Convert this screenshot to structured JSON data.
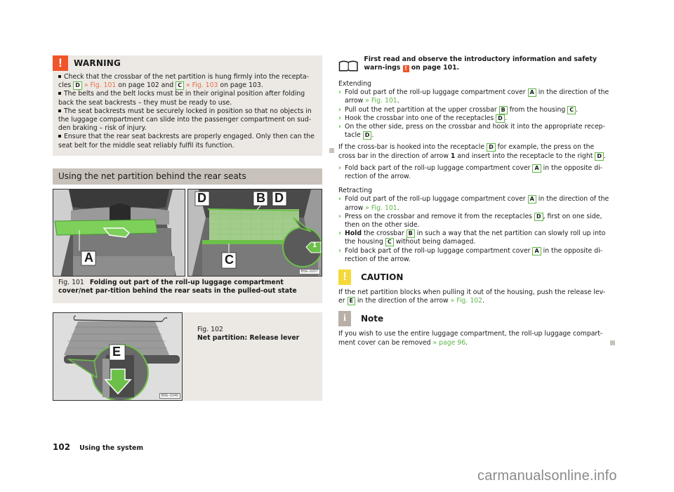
{
  "warning": {
    "icon": "exclamation-icon",
    "title": "WARNING",
    "items": [
      {
        "pre": "Check that the crossbar of the net partition is hung firmly into the recepta-cles ",
        "label1": "D",
        "link1": "» Fig. 101",
        "mid": " on page 102 and ",
        "label2": "C",
        "link2": "» Fig. 103",
        "post": " on page 103."
      },
      {
        "text": "The belts and the belt locks must be in their original position after folding back the seat backrests – they must be ready to use."
      },
      {
        "text": "The seat backrests must be securely locked in position so that no objects in the luggage compartment can slide into the passenger compartment on sud-den braking – risk of injury."
      },
      {
        "text": "Ensure that the rear seat backrests are properly engaged. Only then can the seat belt for the middle seat reliably fulfil its function."
      }
    ]
  },
  "section": {
    "title": "Using the net partition behind the rear seats"
  },
  "fig101": {
    "number": "Fig. 101",
    "title": "Folding out part of the roll-up luggage compartment cover/net par-tition behind the rear seats in the pulled-out state",
    "code": "B5E-0207",
    "labels": {
      "a": "A",
      "b": "B",
      "c": "C",
      "d1": "D",
      "d2": "D",
      "arrow": "1"
    }
  },
  "fig102": {
    "number": "Fig. 102",
    "title": "Net partition: Release lever",
    "code": "B5E-0249",
    "label": "E"
  },
  "intro": {
    "icon": "book-icon",
    "text_pre": "First read and observe the introductory information and safety warn-ings ",
    "text_post": " on page 101."
  },
  "extending": {
    "title": "Extending",
    "step1": {
      "pre": "Fold out part of the roll-up luggage compartment cover ",
      "label": "A",
      "mid": " in the direction of the arrow ",
      "link": "» Fig. 101",
      "post": "."
    },
    "step2": {
      "pre": "Pull out the net partition at the upper crossbar ",
      "label1": "B",
      "mid": " from the housing ",
      "label2": "C",
      "post": "."
    },
    "step3": {
      "pre": "Hook the crossbar into one of the receptacles ",
      "label": "D",
      "post": "."
    },
    "step4": {
      "pre": "On the other side, press on the crossbar and hook it into the appropriate recep-tacle ",
      "label": "D",
      "post": "."
    },
    "para": {
      "pre": "If the cross-bar is hooked into the receptacle ",
      "label1": "D",
      "mid1": " for example, the press on the cross bar in the direction of arrow ",
      "bold": "1",
      "mid2": " and insert into the receptacle to the right ",
      "label2": "D",
      "post": "."
    },
    "step5": {
      "pre": "Fold back part of the roll-up luggage compartment cover ",
      "label": "A",
      "post": " in the opposite di-rection of the arrow."
    }
  },
  "retracting": {
    "title": "Retracting",
    "step1": {
      "pre": "Fold out part of the roll-up luggage compartment cover ",
      "label": "A",
      "mid": " in the direction of the arrow ",
      "link": "» Fig. 101",
      "post": "."
    },
    "step2": {
      "pre": "Press on the crossbar and remove it from the receptacles ",
      "label": "D",
      "post": ", first on one side, then on the other side."
    },
    "step3": {
      "bold": "Hold",
      "pre": " the crossbar ",
      "label1": "B",
      "mid": " in such a way that the net partition can slowly roll up into the housing ",
      "label2": "C",
      "post": " without being damaged."
    },
    "step4": {
      "pre": "Fold back part of the roll-up luggage compartment cover ",
      "label": "A",
      "post": " in the opposite di-rection of the arrow."
    }
  },
  "caution": {
    "icon": "exclamation-icon",
    "title": "CAUTION",
    "pre": "If the net partition blocks when pulling it out of the housing, push the release lev-er ",
    "label": "E",
    "mid": " in the direction of the arrow ",
    "link": "» Fig. 102",
    "post": "."
  },
  "note": {
    "icon": "info-icon",
    "title": "Note",
    "pre": "If you wish to use the entire luggage compartment, the roll-up luggage compart-ment cover can be removed ",
    "link": "» page 96",
    "post": "."
  },
  "footer": {
    "page_number": "102",
    "section": "Using the system"
  },
  "watermark": "carmanualsonline.info",
  "colors": {
    "warning": "#f0552a",
    "caution": "#f5d93a",
    "note": "#b8b0a6",
    "label_border": "#5fb54a",
    "link_orange": "#e8704a",
    "link_green": "#5fb54a",
    "box_bg": "#ece9e4",
    "section_bg": "#c8c2ba"
  }
}
